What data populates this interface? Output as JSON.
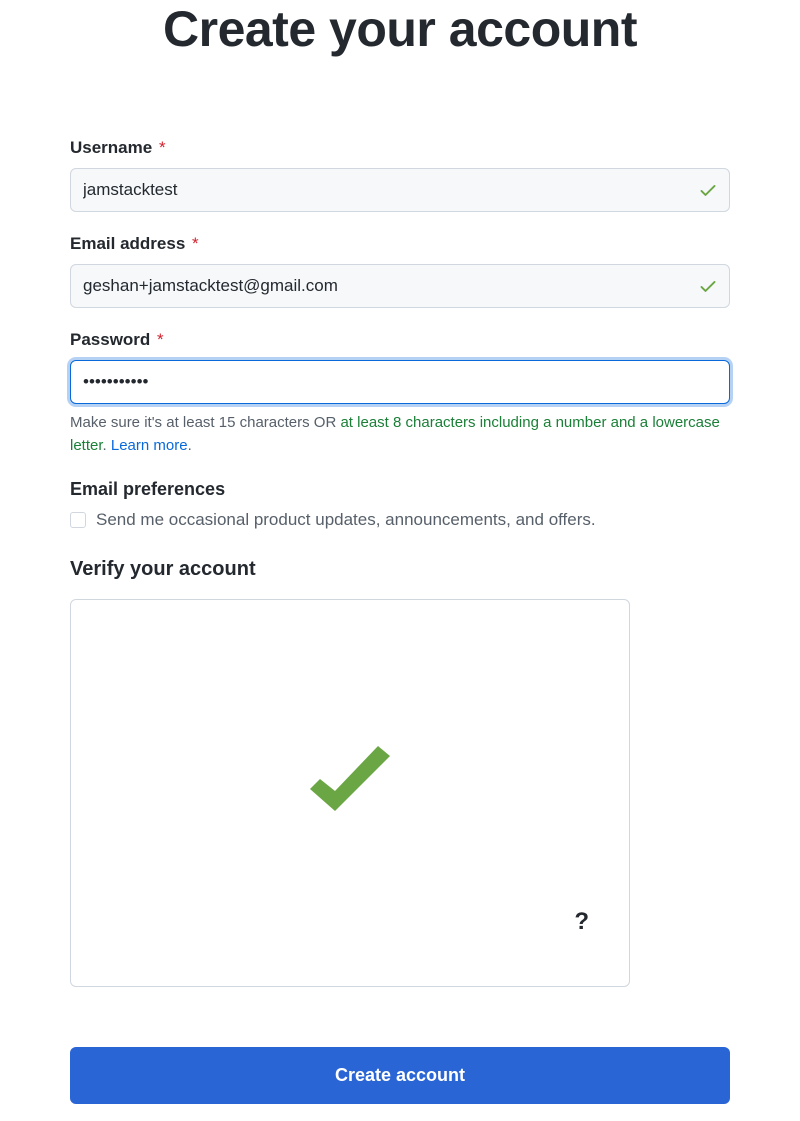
{
  "page_title": "Create your account",
  "fields": {
    "username": {
      "label": "Username",
      "value": "jamstacktest",
      "valid": true
    },
    "email": {
      "label": "Email address",
      "value": "geshan+jamstacktest@gmail.com",
      "valid": true
    },
    "password": {
      "label": "Password",
      "value": "•••••••••••",
      "hint_prefix": "Make sure it's at least 15 characters OR ",
      "hint_condition": "at least 8 characters including a number and a lowercase letter",
      "hint_period": ". ",
      "learn_more": "Learn more",
      "hint_trailing": "."
    }
  },
  "email_prefs": {
    "heading": "Email preferences",
    "checkbox_label": "Send me occasional product updates, announcements, and offers."
  },
  "verify": {
    "heading": "Verify your account",
    "help": "?"
  },
  "create_button": "Create account",
  "required_marker": "*",
  "colors": {
    "accent": "#2a65d6",
    "success": "#6ba644",
    "text": "#24292f",
    "muted": "#57606a",
    "link": "#0969da",
    "green_text": "#1a7f37",
    "border": "#d0d7de"
  }
}
